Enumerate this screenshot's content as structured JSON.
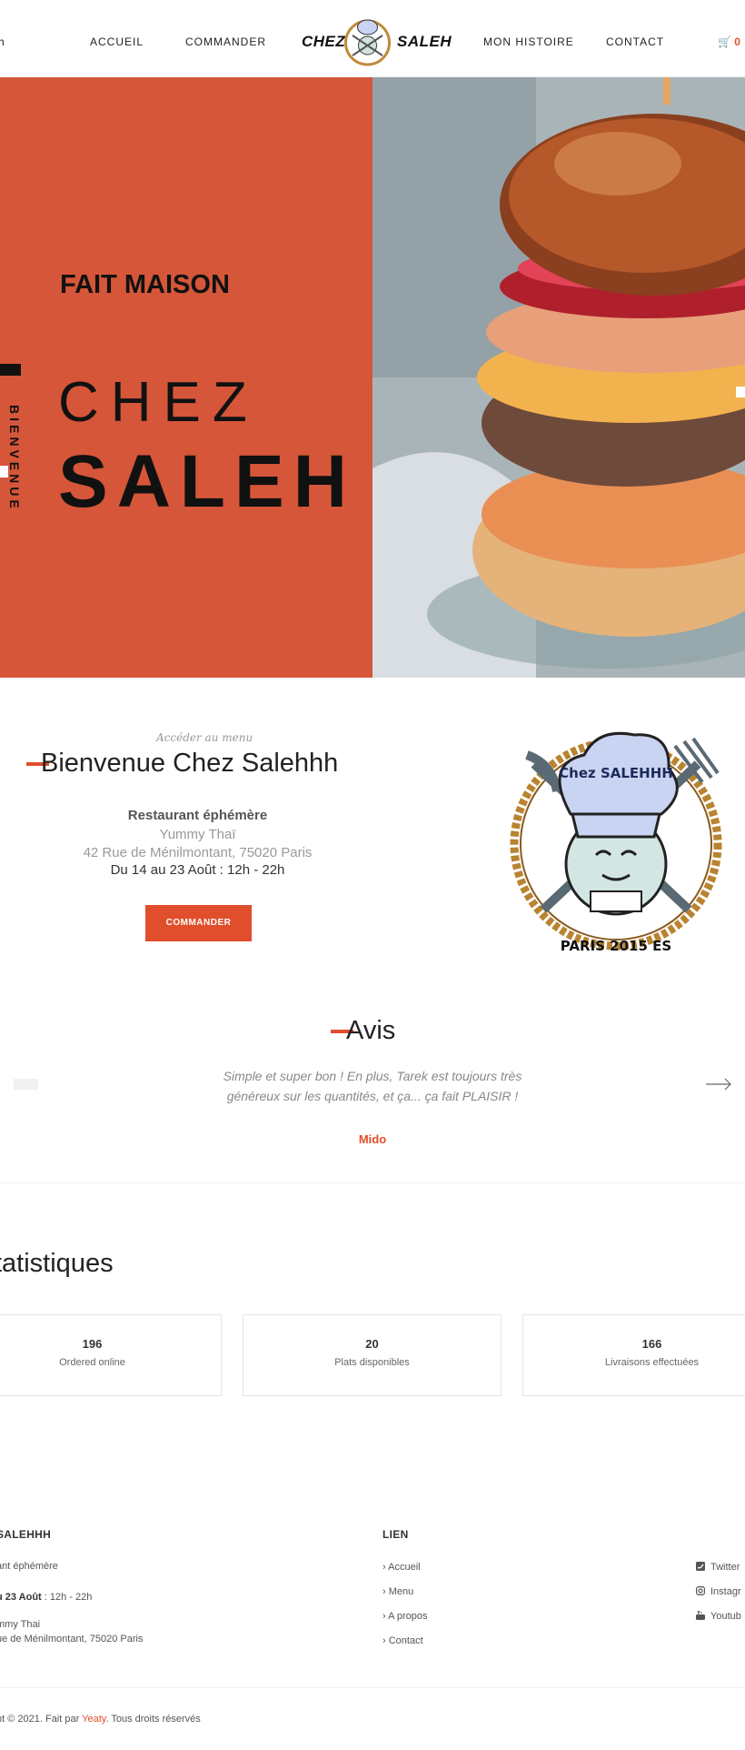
{
  "nav": {
    "clipped_left": "h",
    "items": [
      "ACCUEIL",
      "COMMANDER",
      "MON HISTOIRE",
      "CONTACT"
    ],
    "brand_left": "CHEZ",
    "brand_right": "SALEH",
    "cart_count": "0"
  },
  "hero": {
    "kicker": "FAIT MAISON",
    "line1": "CHEZ",
    "line2": "SALEH",
    "side_label": "BIENVENUE"
  },
  "welcome": {
    "link": "Accéder au menu",
    "title": "Bienvenue Chez Salehhh",
    "subtitle": "Restaurant éphémère",
    "venue": "Yummy Thaï",
    "address": "42 Rue de Ménilmontant, 75020 Paris",
    "dates": "Du 14 au 23 Août : 12h - 22h",
    "button": "COMMANDER"
  },
  "logo": {
    "hat_text": "Chez SALEHHH",
    "ring_text": "PARIS 2015 ES"
  },
  "reviews": {
    "title": "Avis",
    "quote": "Simple et super bon ! En plus, Tarek est toujours très généreux sur les quantités, et ça... ça fait PLAISIR !",
    "author": "Mido"
  },
  "stats": {
    "title": "tatistiques",
    "items": [
      {
        "value": "196",
        "label": "Ordered online"
      },
      {
        "value": "20",
        "label": "Plats disponibles"
      },
      {
        "value": "166",
        "label": "Livraisons effectuées"
      }
    ]
  },
  "footer": {
    "col1_title": "SALEHHH",
    "col1_line1": "ant éphémère",
    "col1_dates_bold": "u 23 Août",
    "col1_dates_rest": " : 12h - 22h",
    "col1_venue": "mmy Thai",
    "col1_address": "ue de Ménilmontant, 75020 Paris",
    "col2_title": "LIEN",
    "links": [
      "Accueil",
      "Menu",
      "A propos",
      "Contact"
    ],
    "social": [
      "Twitter",
      "Instagr",
      "Youtub"
    ],
    "copy_prefix": "ht © 2021. Fait par ",
    "copy_brand": "Yeaty",
    "copy_suffix": ". Tous droits réservés"
  },
  "colors": {
    "accent": "#e04e2b",
    "hero_panel": "#d65639"
  }
}
